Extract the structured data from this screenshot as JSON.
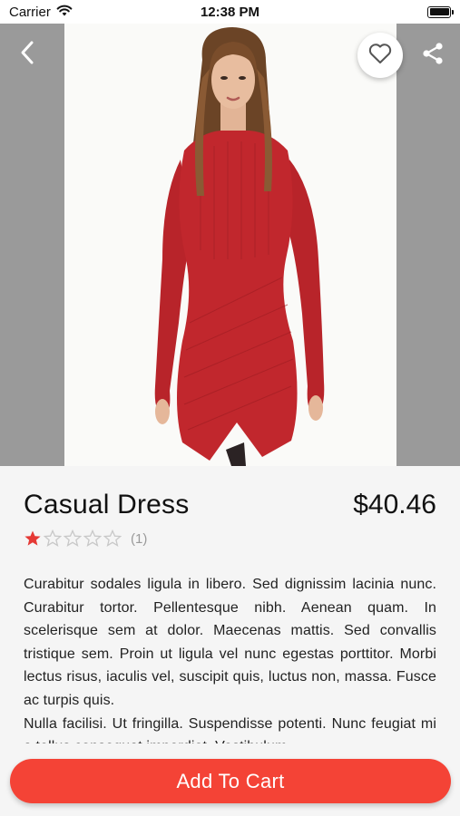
{
  "status_bar": {
    "carrier": "Carrier",
    "time": "12:38 PM"
  },
  "hero": {
    "image_alt": "Woman wearing a red fitted dress"
  },
  "product": {
    "title": "Casual Dress",
    "price": "$40.46",
    "rating": 1,
    "rating_max": 5,
    "rating_count": "(1)",
    "description": [
      "Curabitur sodales ligula in libero. Sed dignissim lacinia nunc. Curabitur tortor. Pellentesque nibh. Aenean quam. In scelerisque sem at dolor. Maecenas mattis. Sed convallis tristique sem. Proin ut ligula vel nunc egestas porttitor. Morbi lectus risus, iaculis vel, suscipit quis, luctus non, massa. Fusce ac turpis quis.",
      "Nulla facilisi. Ut fringilla. Suspendisse potenti. Nunc feugiat mi a tellus consequat imperdiet. Vestibulum"
    ]
  },
  "actions": {
    "add_to_cart": "Add To Cart"
  },
  "colors": {
    "accent": "#f44336",
    "star_filled": "#e53935",
    "star_empty": "#c8c8c8",
    "side_panel": "#9a9a9a"
  },
  "icons": {
    "back": "chevron-left-icon",
    "favorite": "heart-outline-icon",
    "share": "share-icon",
    "wifi": "wifi-icon",
    "battery": "battery-icon"
  }
}
